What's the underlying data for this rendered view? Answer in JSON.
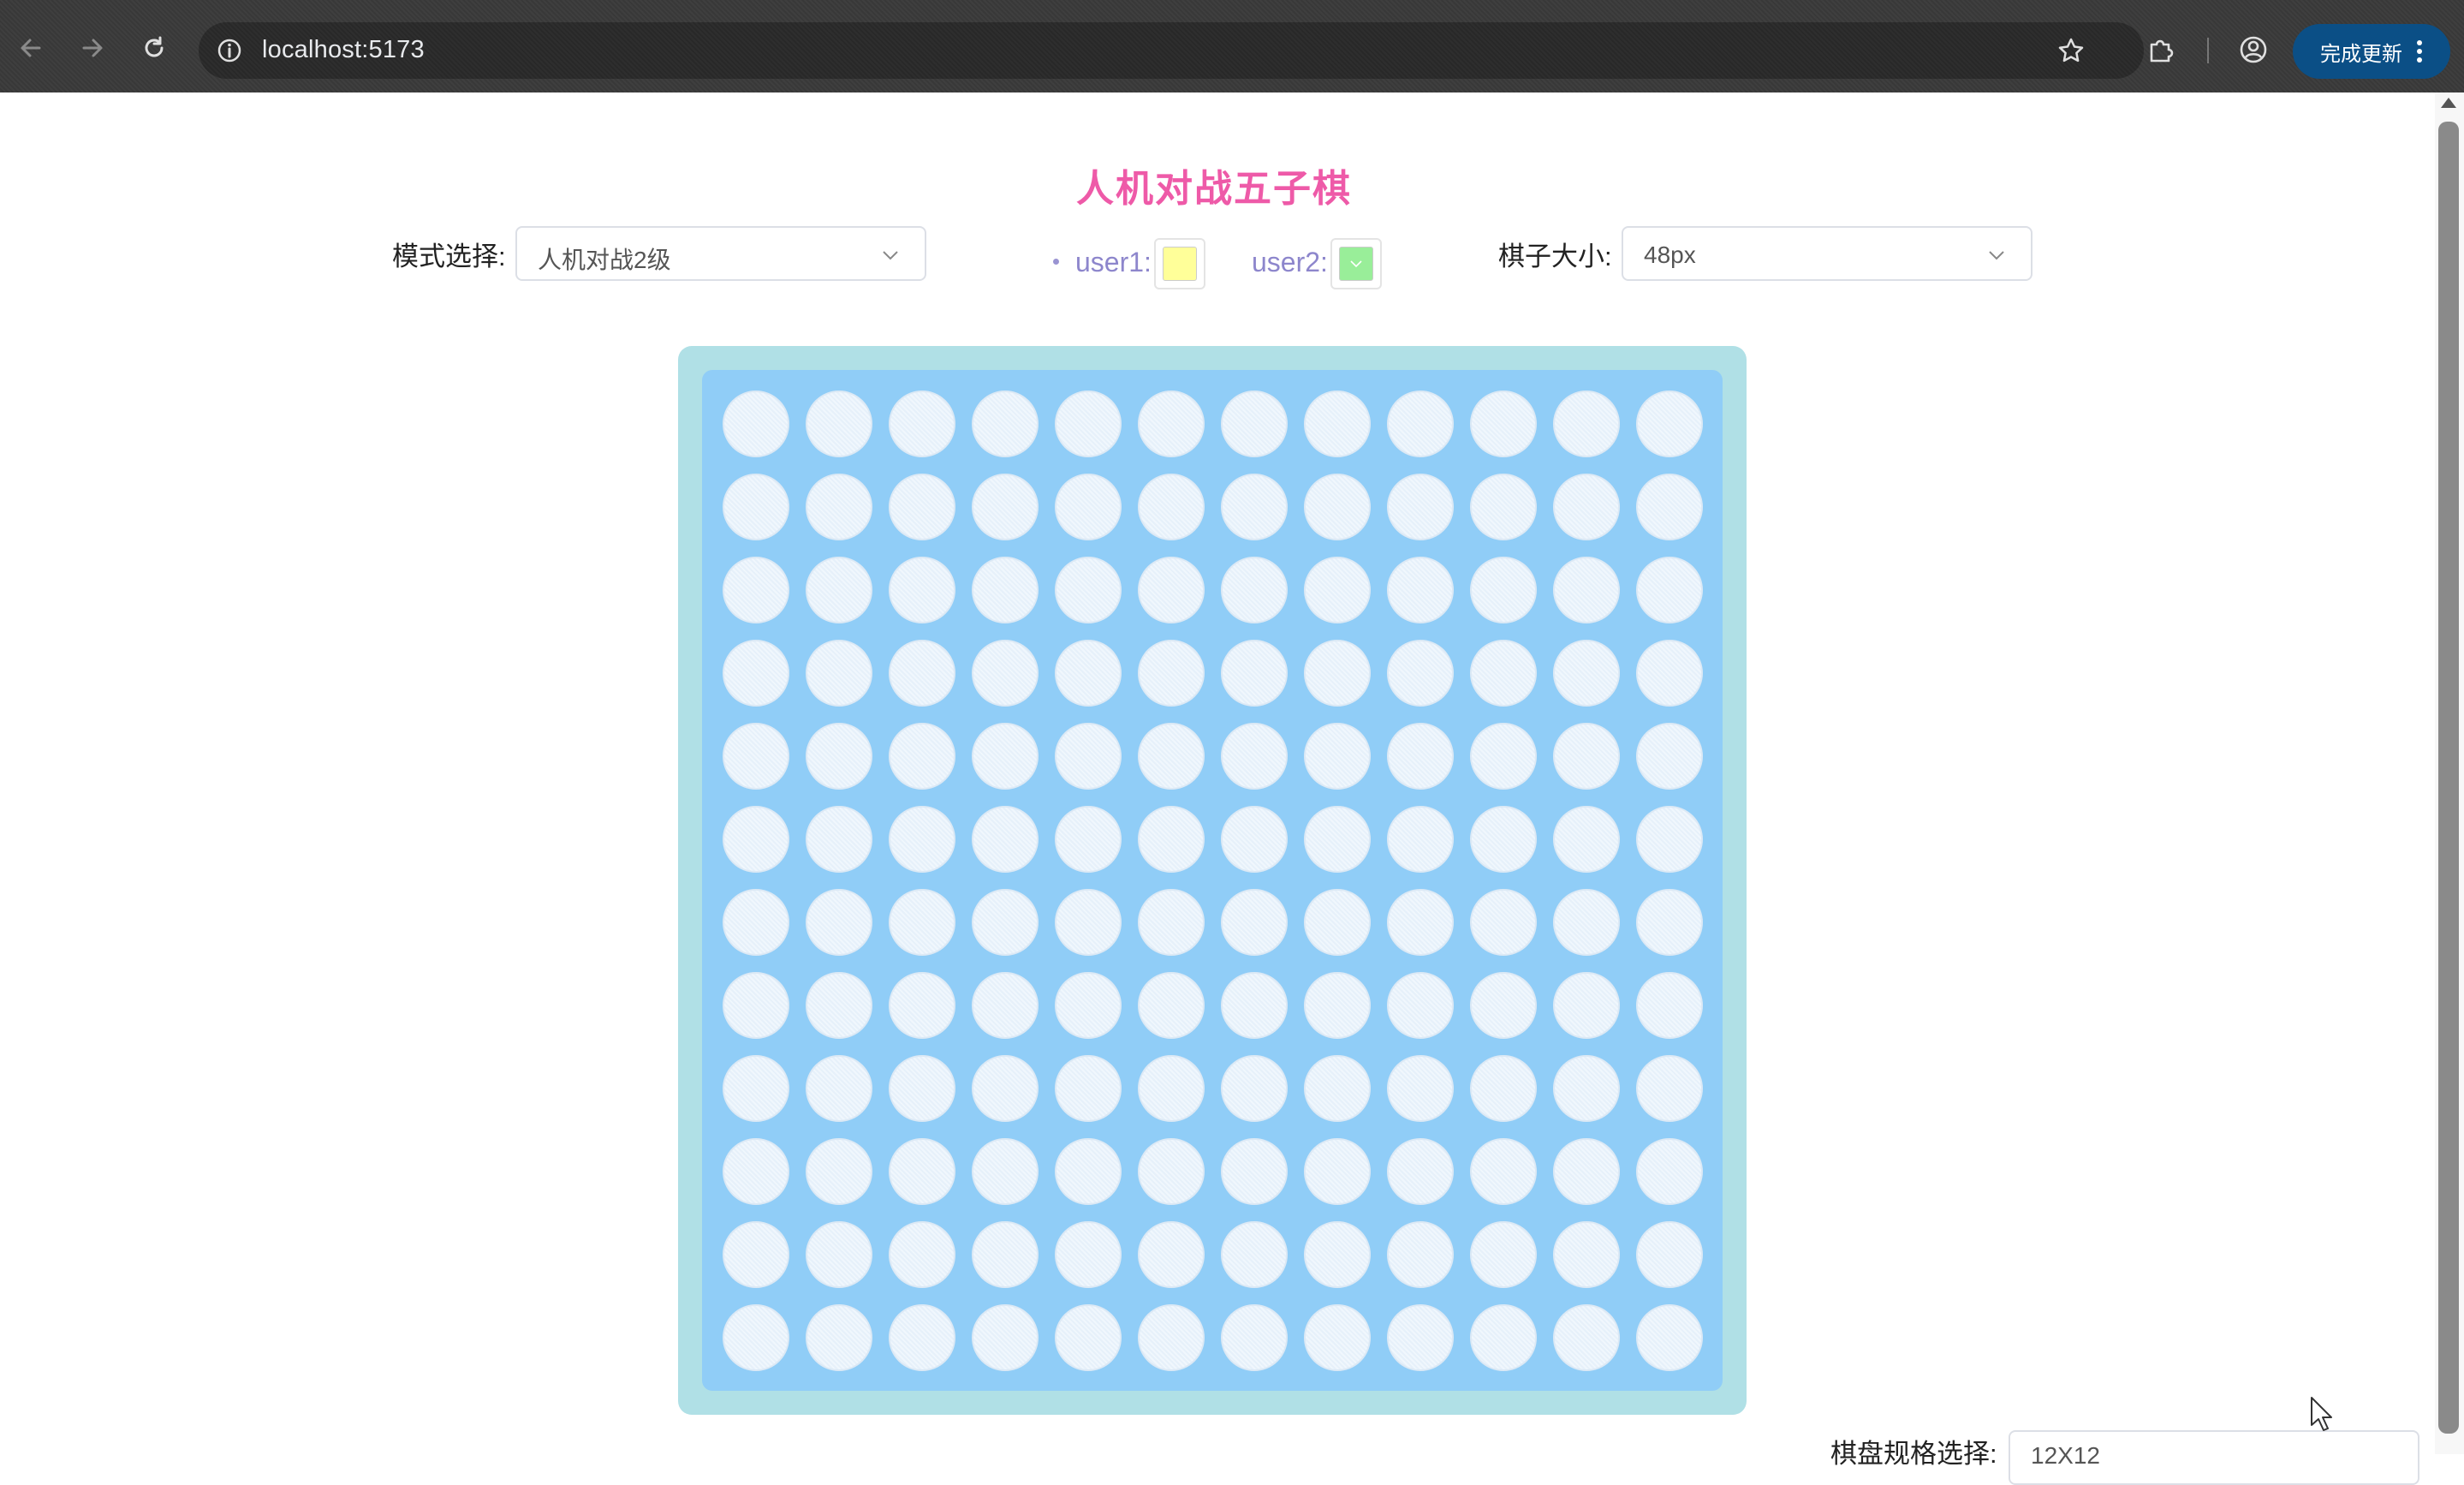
{
  "browser": {
    "url": "localhost:5173",
    "update_button_label": "完成更新"
  },
  "page": {
    "title": "人机对战五子棋",
    "mode": {
      "label": "模式选择:",
      "value": "人机对战2级"
    },
    "users": [
      {
        "label": "user1:",
        "color": "#ffff99"
      },
      {
        "label": "user2:",
        "color": "#99ee99"
      }
    ],
    "piece_size": {
      "label": "棋子大小:",
      "value": "48px"
    },
    "board": {
      "rows": 12,
      "cols": 12,
      "outer_color": "#b0e0e6",
      "inner_color": "#90cdf7"
    },
    "board_size": {
      "label": "棋盘规格选择:",
      "value": "12X12"
    }
  },
  "icons": [
    "back-arrow-icon",
    "forward-arrow-icon",
    "reload-icon",
    "site-info-icon",
    "bookmark-star-icon",
    "extensions-icon",
    "profile-icon",
    "more-vertical-icon",
    "chevron-down-icon"
  ]
}
